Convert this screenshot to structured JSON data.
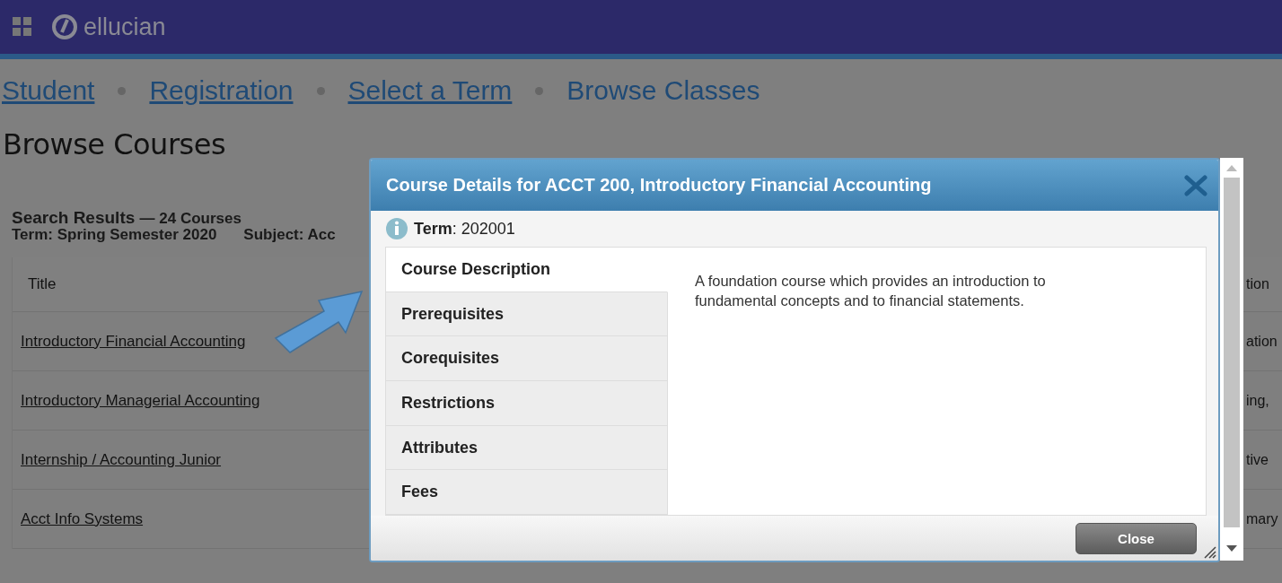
{
  "header": {
    "logo_text": "ellucian"
  },
  "breadcrumbs": [
    {
      "label": "Student",
      "kind": "link"
    },
    {
      "label": "Registration",
      "kind": "link"
    },
    {
      "label": "Select a Term",
      "kind": "link"
    },
    {
      "label": "Browse Classes",
      "kind": "current"
    }
  ],
  "page_title": "Browse Courses",
  "results": {
    "heading": "Search Results",
    "count": "— 24 Courses",
    "term": "Term: Spring Semester 2020",
    "subject": "Subject: Acc"
  },
  "table": {
    "columns": [
      {
        "label": "Title"
      },
      {
        "label": "tion"
      }
    ],
    "rows": [
      {
        "title": "Introductory Financial Accounting",
        "column_2": "ation"
      },
      {
        "title": "Introductory Managerial Accounting",
        "column_2": "ing,"
      },
      {
        "title": "Internship / Accounting Junior",
        "column_2": "tive"
      },
      {
        "title": "Acct Info Systems",
        "column_2": "mary"
      }
    ]
  },
  "modal": {
    "title": "Course Details for ACCT 200, Introductory Financial Accounting",
    "term": "**Term**: 202001",
    "tabs": [
      {
        "label": "Course Description",
        "selected": true
      },
      {
        "label": "Prerequisites",
        "selected": false
      },
      {
        "label": "Corequisites",
        "selected": false
      },
      {
        "label": "Restrictions",
        "selected": false
      },
      {
        "label": "Attributes",
        "selected": false
      },
      {
        "label": "Fees",
        "selected": false
      }
    ],
    "description": "A foundation course which provides an introduction to fundamental concepts and to financial statements.",
    "close_button": "Close"
  }
}
